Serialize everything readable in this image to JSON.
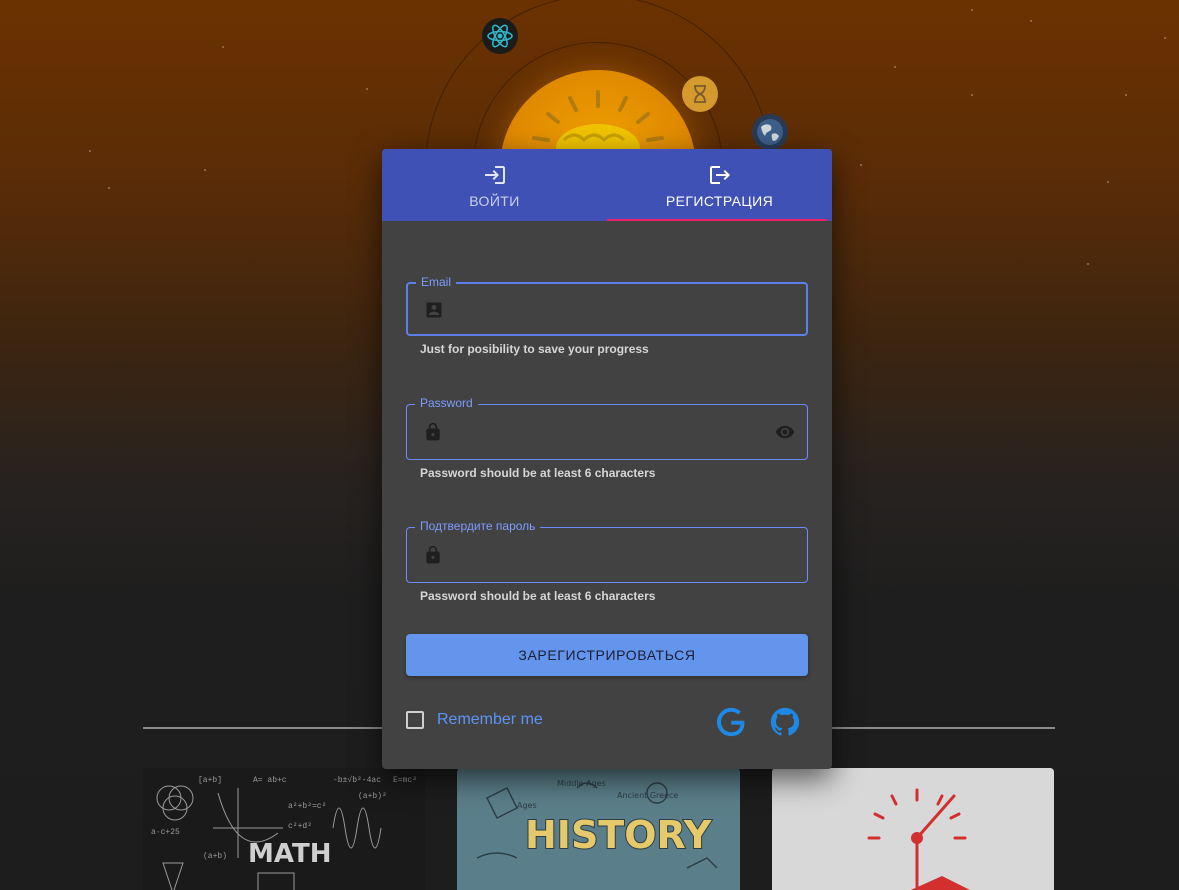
{
  "tabs": {
    "login_label": "ВОЙТИ",
    "register_label": "РЕГИСТРАЦИЯ",
    "active": "register"
  },
  "form": {
    "email": {
      "label": "Email",
      "value": "",
      "helper": "Just for posibility to save your progress",
      "icon": "account-box-icon"
    },
    "password": {
      "label": "Password",
      "value": "",
      "helper": "Password should be at least 6 characters",
      "icon": "lock-icon",
      "toggle_icon": "eye-icon"
    },
    "confirm_password": {
      "label": "Подтвердите пароль",
      "value": "",
      "helper": "Password should be at least 6 characters",
      "icon": "lock-icon"
    },
    "submit_label": "ЗАРЕГИСТРИРОВАТЬСЯ"
  },
  "remember": {
    "label": "Remember me",
    "checked": false
  },
  "social": [
    "google-icon",
    "github-icon"
  ],
  "background": {
    "orbit_icons": [
      "react-icon",
      "hourglass-icon",
      "globe-icon"
    ],
    "center_icon": "brain-icon",
    "cards": [
      {
        "name": "math-card",
        "title": "MATH"
      },
      {
        "name": "history-card",
        "title": "HISTORY"
      },
      {
        "name": "time-card",
        "title": ""
      }
    ]
  },
  "colors": {
    "tab_bar": "#3f51b5",
    "tab_indicator": "#e91e63",
    "dialog_bg": "#424242",
    "accent": "#6495ed",
    "field_border": "#6b8bff"
  }
}
